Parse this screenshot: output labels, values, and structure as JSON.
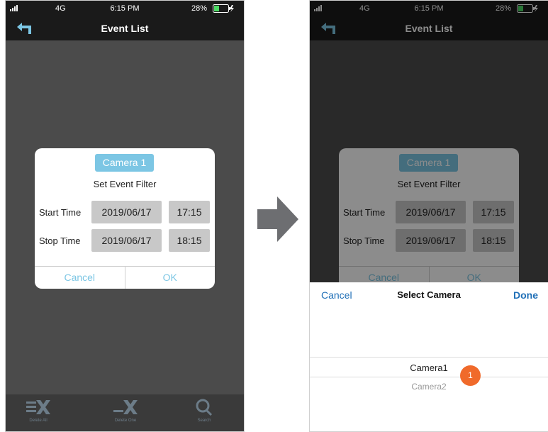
{
  "status": {
    "network": "4G",
    "time": "6:15 PM",
    "battery": "28%"
  },
  "nav": {
    "title": "Event List"
  },
  "dialog": {
    "camera": "Camera 1",
    "title": "Set Event Filter",
    "start_label": "Start Time",
    "start_date": "2019/06/17",
    "start_time": "17:15",
    "stop_label": "Stop Time",
    "stop_date": "2019/06/17",
    "stop_time": "18:15",
    "cancel": "Cancel",
    "ok": "OK"
  },
  "picker": {
    "cancel": "Cancel",
    "title": "Select Camera",
    "done": "Done",
    "options": [
      "Camera1",
      "Camera2"
    ]
  },
  "badge": "1",
  "colors": {
    "accent": "#7cc6e4",
    "link": "#1f6fb7",
    "badge": "#f06a2b"
  }
}
